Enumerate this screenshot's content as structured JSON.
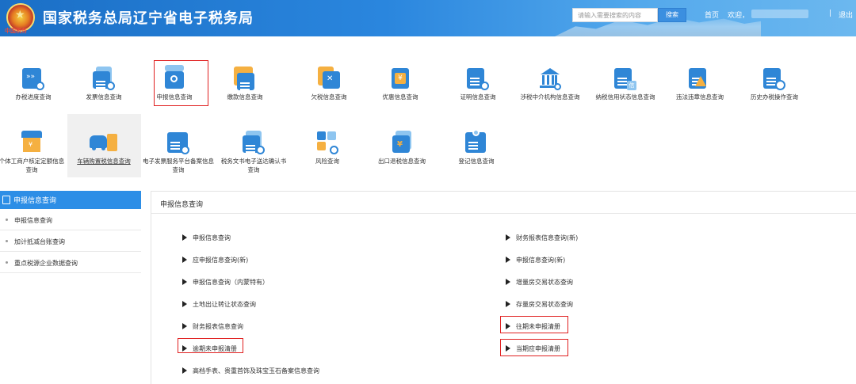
{
  "header": {
    "title": "国家税务总局辽宁省电子税务局",
    "emblem_text": "中国税务",
    "search_placeholder": "请输入需要搜索的内容",
    "search_button": "搜索",
    "home_link": "首页",
    "welcome": "欢迎，",
    "separator": "|",
    "logout": "退出"
  },
  "tiles_row1": [
    {
      "label": "办税进度查询",
      "icon": "progress-search-icon"
    },
    {
      "label": "发票信息查询",
      "icon": "invoice-search-icon"
    },
    {
      "label": "申报信息查询",
      "icon": "declaration-search-icon"
    },
    {
      "label": "缴款信息查询",
      "icon": "payment-search-icon"
    },
    {
      "label": "欠税信息查询",
      "icon": "arrears-search-icon"
    },
    {
      "label": "优惠信息查询",
      "icon": "preferential-search-icon"
    },
    {
      "label": "证明信息查询",
      "icon": "certificate-search-icon"
    },
    {
      "label": "涉税中介机构信息查询",
      "icon": "agency-search-icon"
    },
    {
      "label": "纳税信用状态信息查询",
      "icon": "credit-status-icon"
    },
    {
      "label": "违法违章信息查询",
      "icon": "violation-search-icon"
    },
    {
      "label": "历史办税操作查询",
      "icon": "history-operation-icon"
    }
  ],
  "tiles_row2": [
    {
      "label": "个体工商户核定定额信息查询",
      "icon": "individual-quota-icon"
    },
    {
      "label": "车辆购置税信息查询",
      "icon": "vehicle-tax-icon"
    },
    {
      "label": "电子发票服务平台备案信息查询",
      "icon": "e-invoice-record-icon"
    },
    {
      "label": "税务文书电子送达确认书查询",
      "icon": "document-delivery-icon"
    },
    {
      "label": "风险查询",
      "icon": "risk-search-icon"
    },
    {
      "label": "出口退税信息查询",
      "icon": "export-rebate-icon"
    },
    {
      "label": "登记信息查询",
      "icon": "registration-search-icon"
    }
  ],
  "sidebar": {
    "title": "申报信息查询",
    "items": [
      "申报信息查询",
      "加计抵减台账查询",
      "重点税源企业数据查询"
    ]
  },
  "panel": {
    "title": "申报信息查询",
    "left_links": [
      "申报信息查询",
      "应申报信息查询(新)",
      "申报信息查询（内蒙特有）",
      "土地出让转让状态查询",
      "财务报表信息查询",
      "逾期未申报清册",
      "高档手表、贵重首饰及珠宝玉石备案信息查询"
    ],
    "right_links": [
      "财务报表信息查询(新)",
      "申报信息查询(新)",
      "增量房交易状态查询",
      "存量房交易状态查询",
      "往期未申报清册",
      "当期应申报清册"
    ]
  },
  "colors": {
    "header_blue": "#1b6fc6",
    "accent": "#2d8ee6",
    "highlight": "#e02020"
  }
}
